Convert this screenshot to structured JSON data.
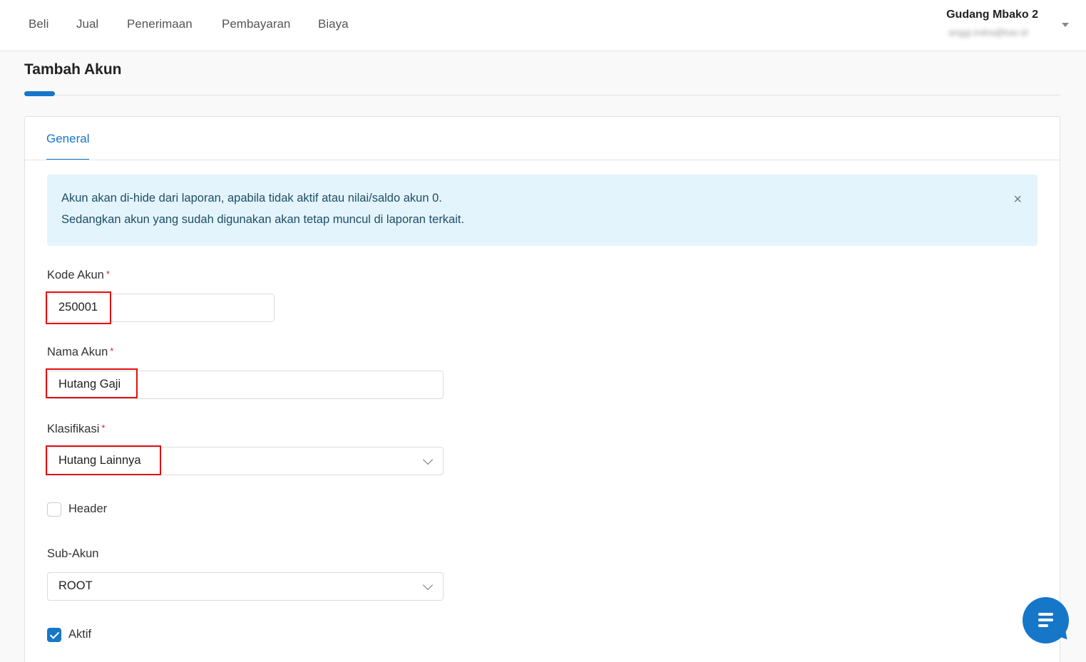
{
  "nav": {
    "items": [
      "Beli",
      "Jual",
      "Penerimaan",
      "Pembayaran",
      "Biaya"
    ],
    "company": "Gudang Mbako 2",
    "email": "anggi.indra@kas.id"
  },
  "page": {
    "title": "Tambah Akun"
  },
  "tabs": {
    "general": "General"
  },
  "alert": {
    "line1": "Akun akan di-hide dari laporan, apabila tidak aktif atau nilai/saldo akun 0.",
    "line2": "Sedangkan akun yang sudah digunakan akan tetap muncul di laporan terkait.",
    "close": "×"
  },
  "form": {
    "kode_akun": {
      "label": "Kode Akun",
      "required": "*",
      "value": "250001"
    },
    "nama_akun": {
      "label": "Nama Akun",
      "required": "*",
      "value": "Hutang Gaji"
    },
    "klasifikasi": {
      "label": "Klasifikasi",
      "required": "*",
      "value": "Hutang Lainnya"
    },
    "header": {
      "label": "Header",
      "checked": false
    },
    "sub_akun": {
      "label": "Sub-Akun",
      "value": "ROOT"
    },
    "aktif": {
      "label": "Aktif",
      "checked": true
    }
  },
  "colors": {
    "accent": "#1677c9",
    "highlight": "#e01010",
    "alert_bg": "#e3f4fc"
  },
  "icons": {
    "dropdown": "chevron-down-icon",
    "close": "close-icon",
    "chat": "chat-icon"
  }
}
